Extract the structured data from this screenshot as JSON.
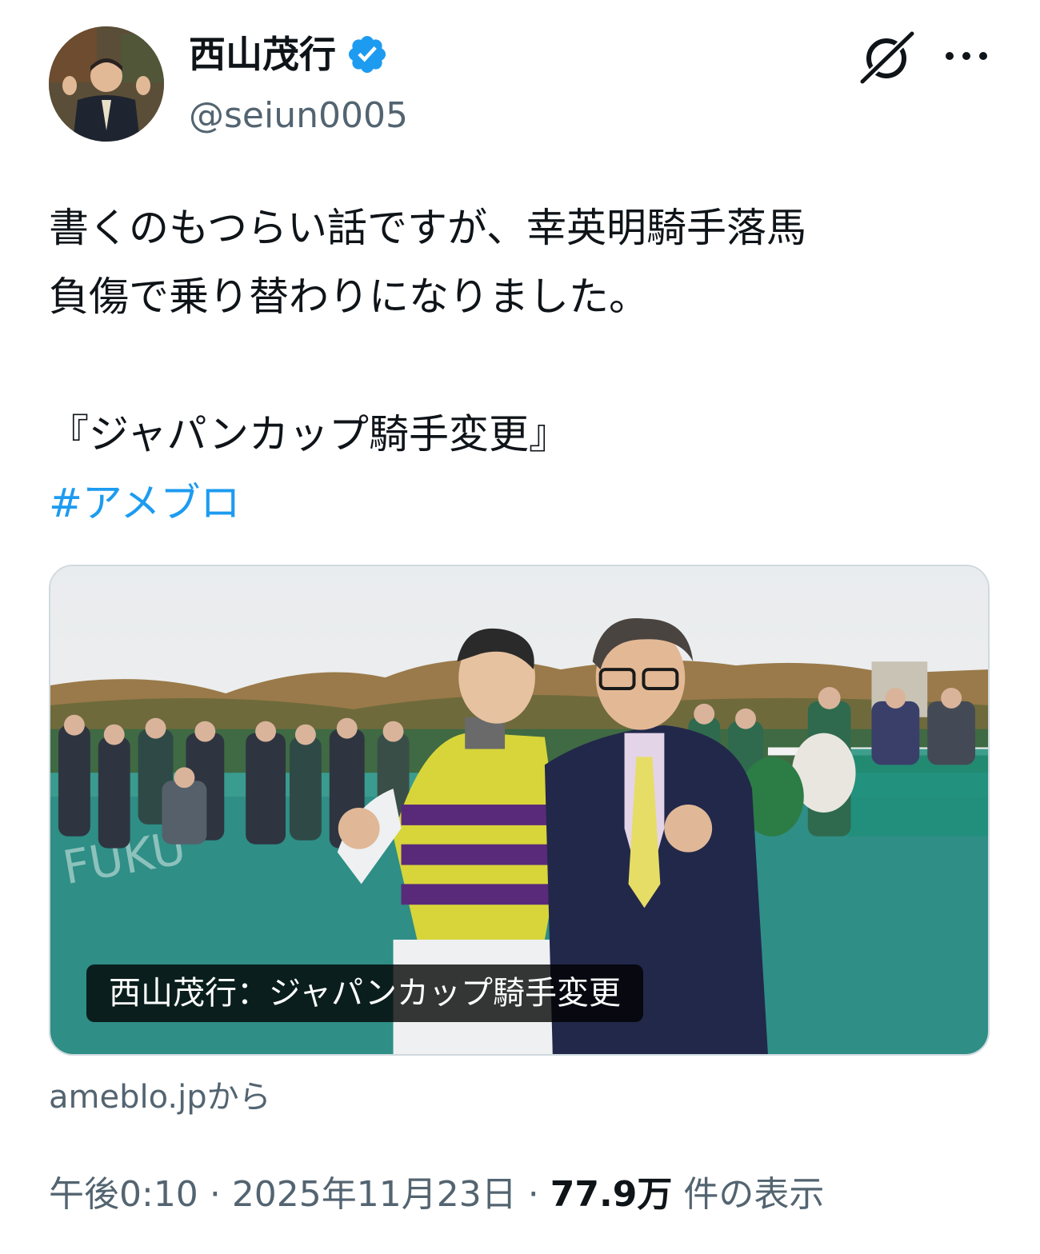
{
  "author": {
    "display_name": "西山茂行",
    "handle": "@seiun0005",
    "verified": true,
    "verified_color": "#1d9bf0"
  },
  "header_icons": [
    "grok-icon",
    "more-icon"
  ],
  "tweet": {
    "lines": [
      "書くのもつらい話ですが、幸英明騎手落馬",
      "負傷で乗り替わりになりました。",
      "",
      "『ジャパンカップ騎手変更』"
    ],
    "hashtag": "#アメブロ",
    "hashtag_color": "#1d9bf0"
  },
  "card": {
    "caption": "西山茂行：ジャパンカップ騎手変更",
    "source": "ameblo.jpから"
  },
  "meta": {
    "time": "午後0:10",
    "separator": "·",
    "date": "2025年11月23日",
    "views_count": "77.9万",
    "views_label": "件の表示"
  }
}
